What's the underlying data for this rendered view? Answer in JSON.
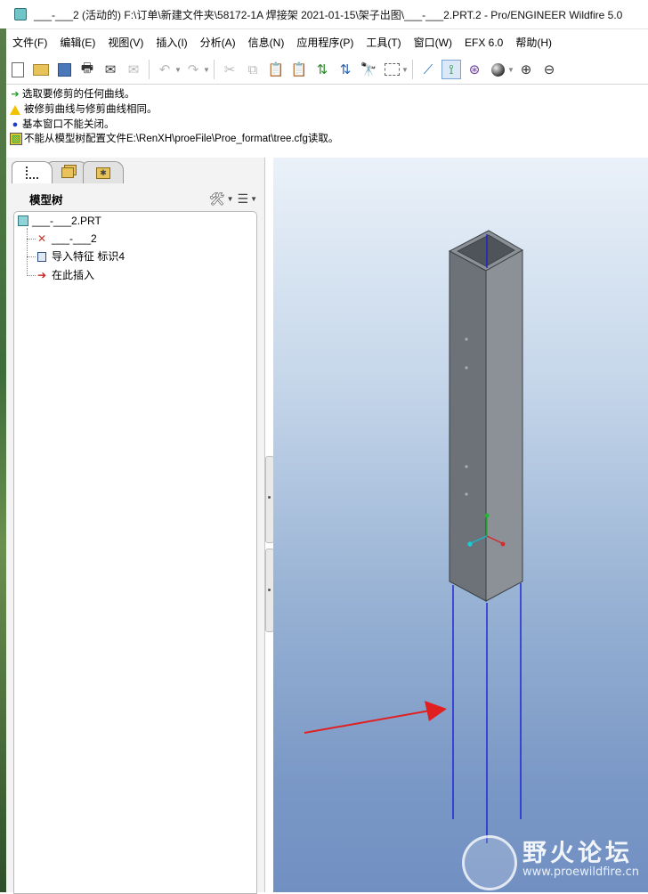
{
  "window": {
    "title": "___-___2 (活动的) F:\\订单\\新建文件夹\\58172-1A 焊接架 2021-01-15\\架子出图\\___-___2.PRT.2 - Pro/ENGINEER Wildfire 5.0"
  },
  "menu": {
    "items": [
      {
        "label": "文件(F)"
      },
      {
        "label": "编辑(E)"
      },
      {
        "label": "视图(V)"
      },
      {
        "label": "插入(I)"
      },
      {
        "label": "分析(A)"
      },
      {
        "label": "信息(N)"
      },
      {
        "label": "应用程序(P)"
      },
      {
        "label": "工具(T)"
      },
      {
        "label": "窗口(W)"
      },
      {
        "label": "EFX 6.0"
      },
      {
        "label": "帮助(H)"
      }
    ]
  },
  "toolbar": {
    "icons": [
      "new-icon",
      "open-icon",
      "save-icon",
      "print-icon",
      "email-icon",
      "email-disabled-icon",
      "undo-icon",
      "redo-icon",
      "cut-icon",
      "copy-icon",
      "paste-icon",
      "paste-special-icon",
      "regenerate-icon",
      "regenerate-manager-icon",
      "find-icon",
      "select-box-icon",
      "datum-display-icon",
      "curve-display-icon",
      "spin-center-icon",
      "shading-icon",
      "zoom-in-icon",
      "zoom-out-icon"
    ]
  },
  "messages": [
    {
      "type": "prompt",
      "icon": "green-arrow-icon",
      "text": "选取要修剪的任何曲线。"
    },
    {
      "type": "warning",
      "icon": "warning-icon",
      "text": "被修剪曲线与修剪曲线相同。"
    },
    {
      "type": "info",
      "icon": "info-dot-icon",
      "text": "基本窗口不能关闭。"
    },
    {
      "type": "error",
      "icon": "error-icon",
      "text": "不能从模型树配置文件E:\\RenXH\\proeFile\\Proe_format\\tree.cfg读取。"
    }
  ],
  "panel": {
    "tabs": [
      "model-tree-tab",
      "layers-tab",
      "favorites-tab"
    ],
    "header": "模型树",
    "tree": [
      {
        "label": "___-___2.PRT",
        "icon": "part-icon",
        "level": 0
      },
      {
        "label": "___-___2",
        "icon": "coordinate-system-icon",
        "level": 1
      },
      {
        "label": "导入特征 标识4",
        "icon": "import-feature-icon",
        "level": 1
      },
      {
        "label": "在此插入",
        "icon": "insert-here-arrow-icon",
        "level": 1
      }
    ]
  },
  "colors": {
    "background_top": "#eaf1f9",
    "background_bottom": "#7190c2",
    "tube_front": "#6c7277",
    "tube_side": "#8b9196",
    "curve": "#1a1fd6",
    "annotation_arrow": "#e02020"
  },
  "watermark": {
    "title": "野火论坛",
    "url": "www.proewildfire.cn"
  }
}
